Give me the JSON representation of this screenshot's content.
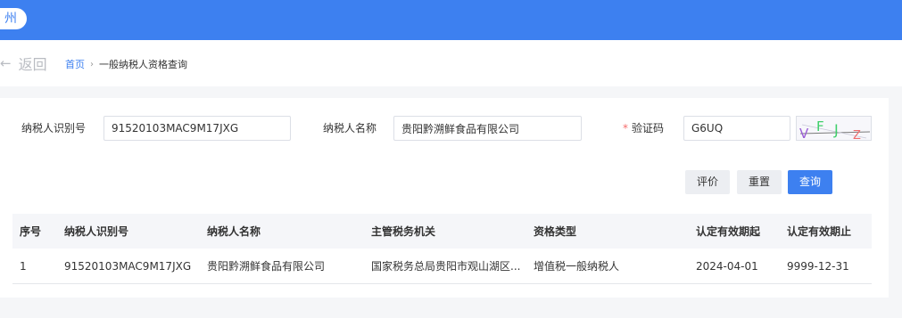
{
  "header": {
    "region_text": "州"
  },
  "nav": {
    "back_label": "返回",
    "back_arrow": "←",
    "breadcrumb": {
      "home": "首页",
      "separator": "›",
      "current": "一般纳税人资格查询"
    }
  },
  "form": {
    "taxpayer_id": {
      "label": "纳税人识别号",
      "value": "91520103MAC9M17JXG"
    },
    "taxpayer_name": {
      "label": "纳税人名称",
      "value": "贵阳黔溯鲜食品有限公司"
    },
    "captcha": {
      "required_mark": "*",
      "label": "验证码",
      "value": "G6UQ",
      "image_chars": [
        "V",
        "F",
        "J",
        "Z"
      ]
    }
  },
  "buttons": {
    "evaluate": "评价",
    "reset": "重置",
    "query": "查询"
  },
  "table": {
    "headers": {
      "seq": "序号",
      "tax_id": "纳税人识别号",
      "name": "纳税人名称",
      "authority": "主管税务机关",
      "qualification": "资格类型",
      "valid_from": "认定有效期起",
      "valid_to": "认定有效期止"
    },
    "rows": [
      {
        "seq": "1",
        "tax_id": "91520103MAC9M17JXG",
        "name": "贵阳黔溯鲜食品有限公司",
        "authority": "国家税务总局贵阳市观山湖区...",
        "qualification": "增值税一般纳税人",
        "valid_from": "2024-04-01",
        "valid_to": "9999-12-31"
      }
    ]
  },
  "colors": {
    "primary": "#3d80f0",
    "required": "#f56c6c",
    "captcha_purple": "#9b5fd6",
    "captcha_green": "#3fcf6a",
    "captcha_red": "#ef6b6b"
  }
}
